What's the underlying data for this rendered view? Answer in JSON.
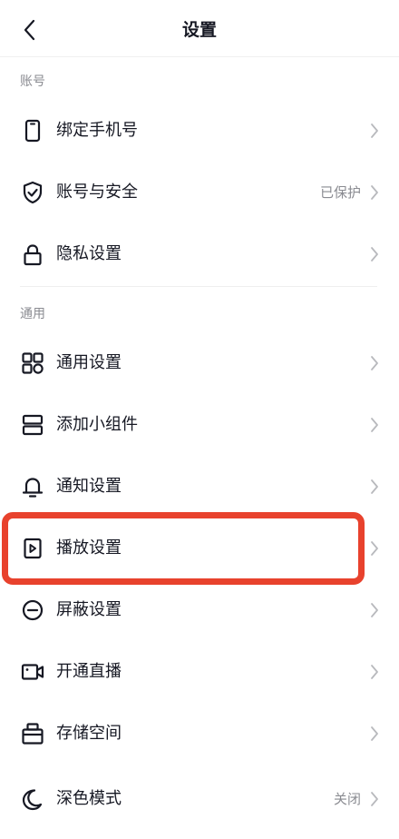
{
  "header": {
    "title": "设置"
  },
  "sections": [
    {
      "label": "账号",
      "items": [
        {
          "label": "绑定手机号",
          "icon": "phone-icon",
          "value": ""
        },
        {
          "label": "账号与安全",
          "icon": "shield-check-icon",
          "value": "已保护"
        },
        {
          "label": "隐私设置",
          "icon": "lock-icon",
          "value": ""
        }
      ]
    },
    {
      "label": "通用",
      "items": [
        {
          "label": "通用设置",
          "icon": "grid-icon",
          "value": ""
        },
        {
          "label": "添加小组件",
          "icon": "widget-icon",
          "value": ""
        },
        {
          "label": "通知设置",
          "icon": "bell-icon",
          "value": ""
        },
        {
          "label": "播放设置",
          "icon": "play-icon",
          "value": ""
        },
        {
          "label": "屏蔽设置",
          "icon": "block-icon",
          "value": ""
        },
        {
          "label": "开通直播",
          "icon": "video-camera-icon",
          "value": ""
        },
        {
          "label": "存储空间",
          "icon": "storage-box-icon",
          "value": ""
        },
        {
          "label": "深色模式",
          "icon": "moon-icon",
          "value": "关闭"
        }
      ]
    }
  ],
  "colors": {
    "highlight": "#e8422d",
    "text": "#161823",
    "secondary": "#8a8b91"
  }
}
